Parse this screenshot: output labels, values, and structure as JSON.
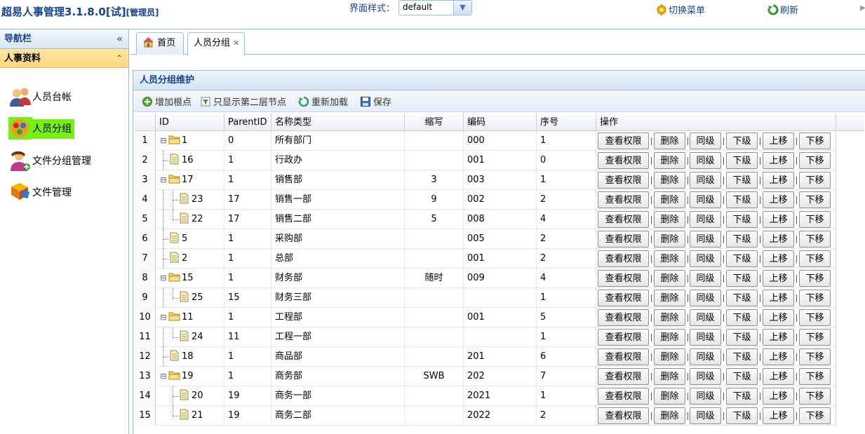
{
  "header": {
    "title": "超易人事管理3.1.8.0[试]",
    "role": "[管理员]",
    "theme_label": "界面样式：",
    "theme_value": "default",
    "switch_menu": "切换菜单",
    "refresh": "刷新"
  },
  "sidebar": {
    "nav_title": "导航栏",
    "section_title": "人事资料",
    "items": [
      {
        "label": "人员台帐",
        "icon": "users-icon"
      },
      {
        "label": "人员分组",
        "icon": "group-icon"
      },
      {
        "label": "文件分组管理",
        "icon": "user-add-icon"
      },
      {
        "label": "文件管理",
        "icon": "files-icon"
      }
    ]
  },
  "tabs": [
    {
      "label": "首页"
    },
    {
      "label": "人员分组"
    }
  ],
  "panel": {
    "title": "人员分组维护",
    "toolbar": {
      "add_root": "增加根点",
      "show_second": "只显示第二层节点",
      "reload": "重新加载",
      "save": "保存"
    }
  },
  "grid": {
    "columns": [
      "ID",
      "ParentID",
      "名称类型",
      "缩写",
      "编码",
      "序号",
      "操作"
    ],
    "ops": [
      "查看权限",
      "删除",
      "同级",
      "下级",
      "上移",
      "下移"
    ],
    "rows": [
      {
        "num": "1",
        "id": "1",
        "pid": "0",
        "name": "所有部门",
        "abbr": "",
        "code": "000",
        "seq": "1"
      },
      {
        "num": "2",
        "id": "16",
        "pid": "1",
        "name": "行政办",
        "abbr": "",
        "code": "001",
        "seq": "0"
      },
      {
        "num": "3",
        "id": "17",
        "pid": "1",
        "name": "销售部",
        "abbr": "3",
        "code": "003",
        "seq": "1"
      },
      {
        "num": "4",
        "id": "23",
        "pid": "17",
        "name": "销售一部",
        "abbr": "9",
        "code": "002",
        "seq": "2"
      },
      {
        "num": "5",
        "id": "22",
        "pid": "17",
        "name": "销售二部",
        "abbr": "5",
        "code": "008",
        "seq": "4"
      },
      {
        "num": "6",
        "id": "5",
        "pid": "1",
        "name": "采购部",
        "abbr": "",
        "code": "005",
        "seq": "2"
      },
      {
        "num": "7",
        "id": "2",
        "pid": "1",
        "name": "总部",
        "abbr": "",
        "code": "001",
        "seq": "2"
      },
      {
        "num": "8",
        "id": "15",
        "pid": "1",
        "name": "财务部",
        "abbr": "随时",
        "code": "009",
        "seq": "4"
      },
      {
        "num": "9",
        "id": "25",
        "pid": "15",
        "name": "财务三部",
        "abbr": "",
        "code": "",
        "seq": "1"
      },
      {
        "num": "10",
        "id": "11",
        "pid": "1",
        "name": "工程部",
        "abbr": "",
        "code": "001",
        "seq": "5"
      },
      {
        "num": "11",
        "id": "24",
        "pid": "11",
        "name": "工程一部",
        "abbr": "",
        "code": "",
        "seq": "1"
      },
      {
        "num": "12",
        "id": "18",
        "pid": "1",
        "name": "商品部",
        "abbr": "",
        "code": "201",
        "seq": "6"
      },
      {
        "num": "13",
        "id": "19",
        "pid": "1",
        "name": "商务部",
        "abbr": "SWB",
        "code": "202",
        "seq": "7"
      },
      {
        "num": "14",
        "id": "20",
        "pid": "19",
        "name": "商务一部",
        "abbr": "",
        "code": "2021",
        "seq": "1"
      },
      {
        "num": "15",
        "id": "21",
        "pid": "19",
        "name": "商务二部",
        "abbr": "",
        "code": "2022",
        "seq": "2"
      }
    ]
  }
}
